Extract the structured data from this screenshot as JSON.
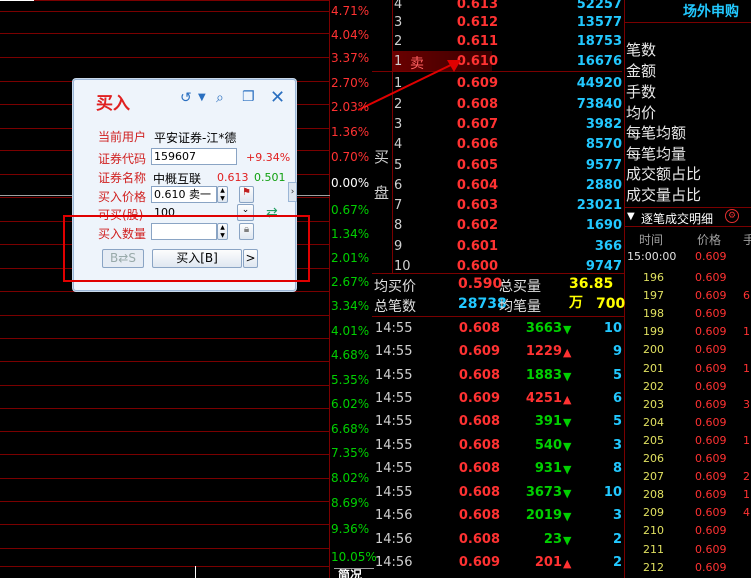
{
  "scale_pcts": [
    {
      "label": "4.71%",
      "cls": "red"
    },
    {
      "label": "4.04%",
      "cls": "red"
    },
    {
      "label": "3.37%",
      "cls": "red"
    },
    {
      "label": "2.70%",
      "cls": "red"
    },
    {
      "label": "2.03%",
      "cls": "red"
    },
    {
      "label": "1.36%",
      "cls": "red"
    },
    {
      "label": "0.70%",
      "cls": "red"
    },
    {
      "label": "0.00%",
      "cls": "white"
    },
    {
      "label": "0.67%",
      "cls": "green"
    },
    {
      "label": "1.34%",
      "cls": "green"
    },
    {
      "label": "2.01%",
      "cls": "green"
    },
    {
      "label": "2.67%",
      "cls": "green"
    },
    {
      "label": "3.34%",
      "cls": "green"
    },
    {
      "label": "4.01%",
      "cls": "green"
    },
    {
      "label": "4.68%",
      "cls": "green"
    },
    {
      "label": "5.35%",
      "cls": "green"
    },
    {
      "label": "6.02%",
      "cls": "green"
    },
    {
      "label": "6.68%",
      "cls": "green"
    },
    {
      "label": "7.35%",
      "cls": "green"
    },
    {
      "label": "8.02%",
      "cls": "green"
    },
    {
      "label": "8.69%",
      "cls": "green"
    },
    {
      "label": "9.36%",
      "cls": "green"
    },
    {
      "label": "10.05%",
      "cls": "green"
    }
  ],
  "sell_rows": [
    {
      "idx": "4",
      "price": "0.613",
      "vol": "52257"
    },
    {
      "idx": "3",
      "price": "0.612",
      "vol": "13577"
    },
    {
      "idx": "2",
      "price": "0.611",
      "vol": "18753"
    },
    {
      "idx": "1",
      "price": "0.610",
      "vol": "16676",
      "label": "卖"
    }
  ],
  "buy_label": "买",
  "buy_label2": "盘",
  "buy_rows": [
    {
      "idx": "1",
      "price": "0.609",
      "vol": "44920"
    },
    {
      "idx": "2",
      "price": "0.608",
      "vol": "73840"
    },
    {
      "idx": "3",
      "price": "0.607",
      "vol": "3982"
    },
    {
      "idx": "4",
      "price": "0.606",
      "vol": "8570"
    },
    {
      "idx": "5",
      "price": "0.605",
      "vol": "9577"
    },
    {
      "idx": "6",
      "price": "0.604",
      "vol": "2880"
    },
    {
      "idx": "7",
      "price": "0.603",
      "vol": "23021"
    },
    {
      "idx": "8",
      "price": "0.602",
      "vol": "1690"
    },
    {
      "idx": "9",
      "price": "0.601",
      "vol": "366"
    },
    {
      "idx": "10",
      "price": "0.600",
      "vol": "9747"
    }
  ],
  "stats": {
    "avg_buy_label": "均买价",
    "avg_buy": "0.590",
    "total_buy_label": "总买量",
    "total_buy": "36.85万",
    "total_orders_label": "总笔数",
    "total_orders": "28738",
    "avg_qty_label": "均笔量",
    "avg_qty": "700"
  },
  "ticks": [
    {
      "time": "14:55",
      "price": "0.608",
      "vol": "3663",
      "dir": "down",
      "cnt": "10"
    },
    {
      "time": "14:55",
      "price": "0.609",
      "vol": "1229",
      "dir": "up",
      "cnt": "9"
    },
    {
      "time": "14:55",
      "price": "0.608",
      "vol": "1883",
      "dir": "down",
      "cnt": "5"
    },
    {
      "time": "14:55",
      "price": "0.609",
      "vol": "4251",
      "dir": "up",
      "cnt": "6"
    },
    {
      "time": "14:55",
      "price": "0.608",
      "vol": "391",
      "dir": "down",
      "cnt": "5"
    },
    {
      "time": "14:55",
      "price": "0.608",
      "vol": "540",
      "dir": "down",
      "cnt": "3"
    },
    {
      "time": "14:55",
      "price": "0.608",
      "vol": "931",
      "dir": "down",
      "cnt": "8"
    },
    {
      "time": "14:55",
      "price": "0.608",
      "vol": "3673",
      "dir": "down",
      "cnt": "10"
    },
    {
      "time": "14:56",
      "price": "0.608",
      "vol": "2019",
      "dir": "down",
      "cnt": "3"
    },
    {
      "time": "14:56",
      "price": "0.608",
      "vol": "23",
      "dir": "down",
      "cnt": "2"
    },
    {
      "time": "14:56",
      "price": "0.609",
      "vol": "201",
      "dir": "up",
      "cnt": "2"
    }
  ],
  "right_panel": {
    "header": "场外申购",
    "labels": [
      "笔数",
      "金额",
      "手数",
      "均价",
      "每笔均额",
      "每笔均量",
      "成交额占比",
      "成交量占比"
    ],
    "detail_title": "逐笔成交明细",
    "col_time": "时间",
    "col_price": "价格",
    "col_extra": "手",
    "first_time": "15:00:00",
    "first_price": "0.609",
    "rows": [
      {
        "seq": "196",
        "price": "0.609",
        "extra": ""
      },
      {
        "seq": "197",
        "price": "0.609",
        "extra": "6"
      },
      {
        "seq": "198",
        "price": "0.609",
        "extra": ""
      },
      {
        "seq": "199",
        "price": "0.609",
        "extra": "1"
      },
      {
        "seq": "200",
        "price": "0.609",
        "extra": ""
      },
      {
        "seq": "201",
        "price": "0.609",
        "extra": "1"
      },
      {
        "seq": "202",
        "price": "0.609",
        "extra": ""
      },
      {
        "seq": "203",
        "price": "0.609",
        "extra": "3"
      },
      {
        "seq": "204",
        "price": "0.609",
        "extra": ""
      },
      {
        "seq": "205",
        "price": "0.609",
        "extra": "1"
      },
      {
        "seq": "206",
        "price": "0.609",
        "extra": ""
      },
      {
        "seq": "207",
        "price": "0.609",
        "extra": "2"
      },
      {
        "seq": "208",
        "price": "0.609",
        "extra": "1"
      },
      {
        "seq": "209",
        "price": "0.609",
        "extra": "4"
      },
      {
        "seq": "210",
        "price": "0.609",
        "extra": ""
      },
      {
        "seq": "211",
        "price": "0.609",
        "extra": ""
      },
      {
        "seq": "212",
        "price": "0.609",
        "extra": ""
      }
    ]
  },
  "dialog": {
    "title": "买入",
    "user_label": "当前用户",
    "user_value": "平安证券-江*德",
    "code_label": "证券代码",
    "code_value": "159607",
    "code_change": "+9.34%",
    "name_label": "证券名称",
    "name_value": "中概互联",
    "name_price1": "0.613",
    "name_price2": "0.501",
    "price_label": "买入价格",
    "price_value": "0.610 卖一",
    "avail_label": "可买(股)",
    "avail_value": "100",
    "qty_label": "买入数量",
    "qty_value": "",
    "bs_label": "B⇄S",
    "buy_btn": "买入[B]",
    "more_btn": ">"
  },
  "bottom_cut": "简况"
}
